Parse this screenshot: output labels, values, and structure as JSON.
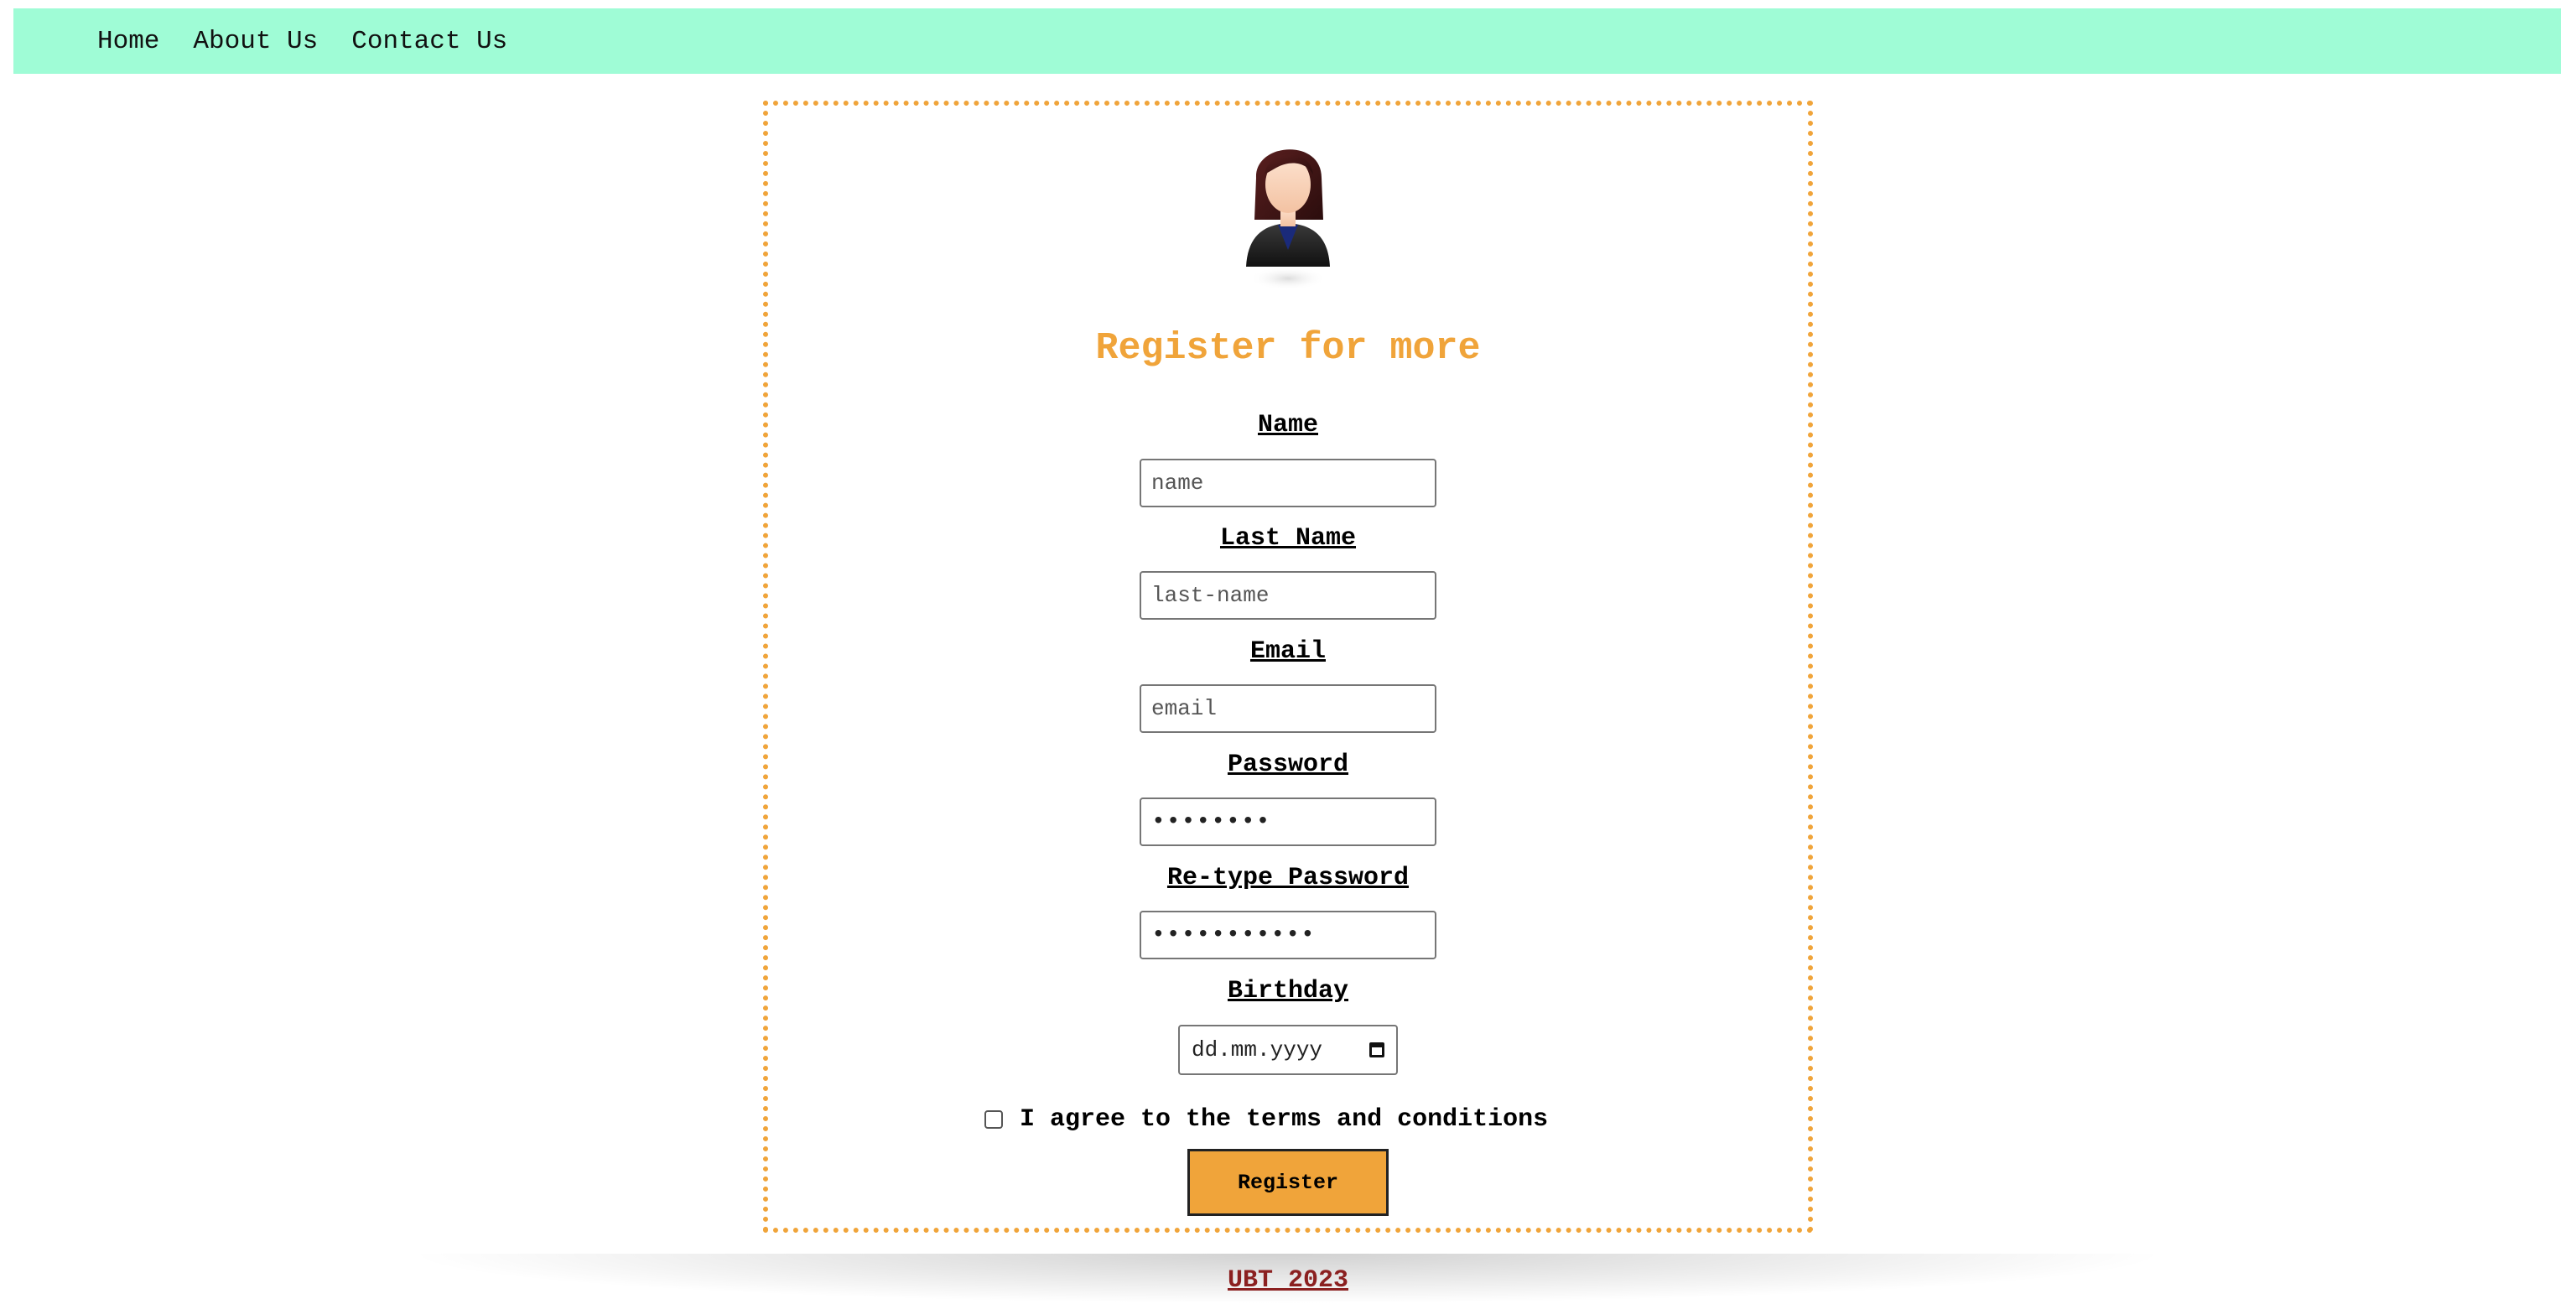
{
  "nav": {
    "items": [
      {
        "label": "Home"
      },
      {
        "label": "About Us"
      },
      {
        "label": "Contact Us"
      }
    ]
  },
  "form": {
    "title": "Register for more",
    "avatar_icon": "user-avatar-icon",
    "fields": {
      "name": {
        "label": "Name",
        "placeholder": "name",
        "value": ""
      },
      "last_name": {
        "label": "Last Name",
        "placeholder": "last-name",
        "value": ""
      },
      "email": {
        "label": "Email",
        "placeholder": "email",
        "value": ""
      },
      "password": {
        "label": "Password",
        "value": "••••••••"
      },
      "retype_password": {
        "label": "Re-type Password",
        "value": "•••••••••••"
      },
      "birthday": {
        "label": "Birthday",
        "placeholder": "dd.mm.yyyy",
        "icon": "calendar-icon"
      }
    },
    "terms_label": "I agree to the terms and conditions",
    "terms_checked": false,
    "submit_label": "Register"
  },
  "footer": {
    "text": "UBT 2023"
  },
  "colors": {
    "nav_bg": "#9ffcd6",
    "accent": "#f0a43a",
    "footer_link": "#8b2020"
  }
}
